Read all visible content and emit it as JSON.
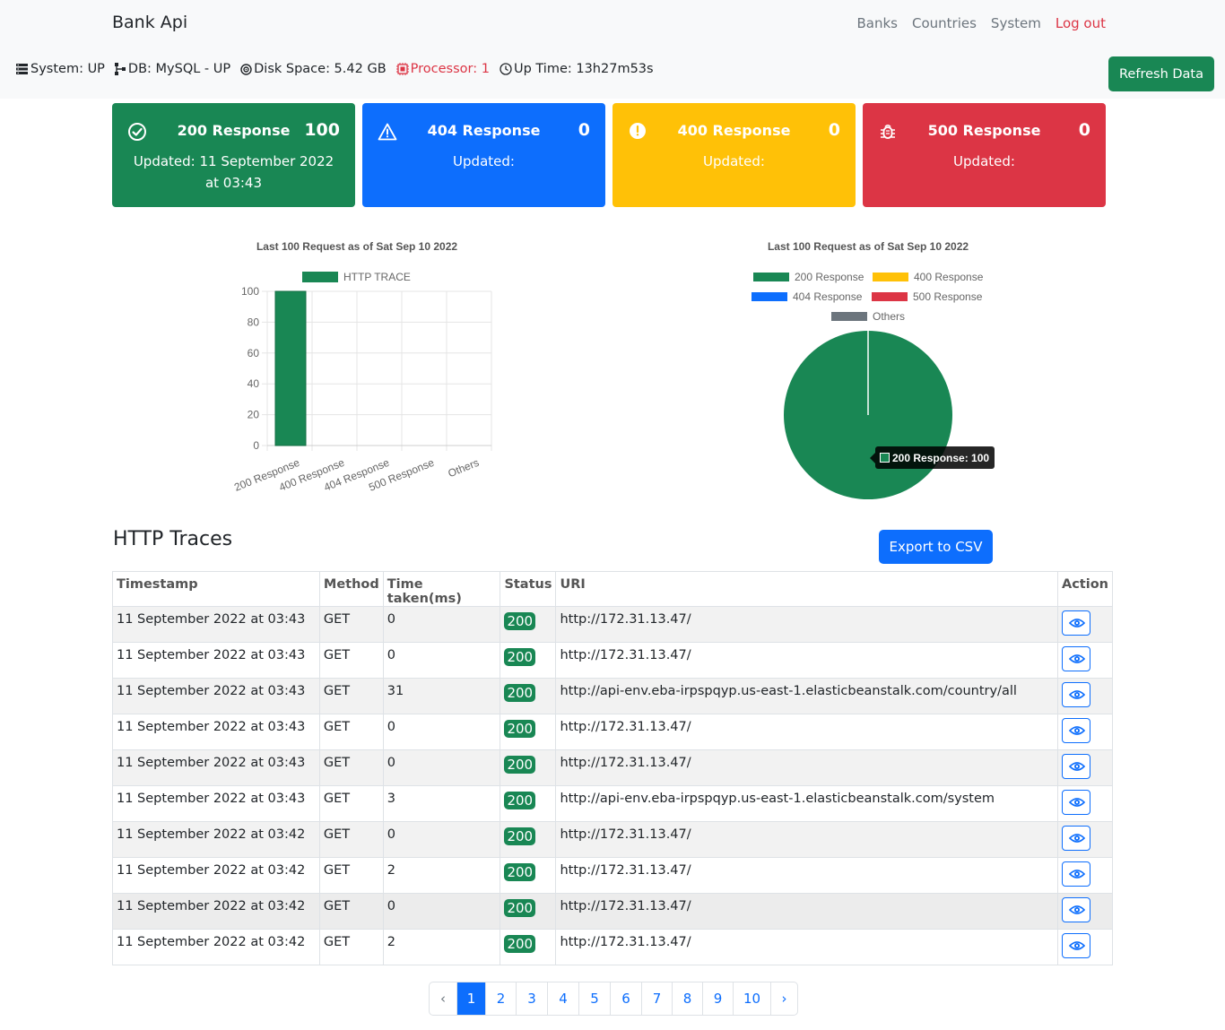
{
  "nav": {
    "brand": "Bank Api",
    "links": [
      "Banks",
      "Countries",
      "System"
    ],
    "logout": "Log out"
  },
  "status": {
    "system": "System: UP",
    "db": "DB: MySQL - UP",
    "disk": "Disk Space: 5.42 GB",
    "processor": "Processor: 1",
    "uptime": "Up Time: 13h27m53s"
  },
  "refresh_label": "Refresh Data",
  "cards": [
    {
      "title": "200 Response",
      "count": "100",
      "updated": "Updated: 11 September 2022 at 03:43",
      "color": "#198754",
      "icon": "check-circle-icon"
    },
    {
      "title": "404 Response",
      "count": "0",
      "updated": "Updated:",
      "color": "#0d6efd",
      "icon": "warning-triangle-icon"
    },
    {
      "title": "400 Response",
      "count": "0",
      "updated": "Updated:",
      "color": "#ffc107",
      "icon": "exclamation-circle-icon"
    },
    {
      "title": "500 Response",
      "count": "0",
      "updated": "Updated:",
      "color": "#dc3545",
      "icon": "bug-icon"
    }
  ],
  "chart_data": [
    {
      "type": "bar",
      "title": "Last 100 Request as of Sat Sep 10 2022",
      "categories": [
        "200 Response",
        "400 Response",
        "404 Response",
        "500 Response",
        "Others"
      ],
      "series": [
        {
          "name": "HTTP TRACE",
          "values": [
            100,
            0,
            0,
            0,
            0
          ]
        }
      ],
      "ylim": [
        0,
        100
      ],
      "yticks": [
        0,
        20,
        40,
        60,
        80,
        100
      ],
      "color": "#198754",
      "legend": "top"
    },
    {
      "type": "pie",
      "title": "Last 100 Request as of Sat Sep 10 2022",
      "labels": [
        "200 Response",
        "400 Response",
        "404 Response",
        "500 Response",
        "Others"
      ],
      "values": [
        100,
        0,
        0,
        0,
        0
      ],
      "colors": [
        "#198754",
        "#ffc107",
        "#0d6efd",
        "#dc3545",
        "#6c757d"
      ],
      "legend": "top",
      "tooltip": "200 Response: 100"
    }
  ],
  "traces": {
    "title": "HTTP Traces",
    "export_label": "Export to CSV",
    "columns": [
      "Timestamp",
      "Method",
      "Time taken(ms)",
      "Status",
      "URI",
      "Action"
    ],
    "rows": [
      {
        "timestamp": "11 September 2022 at 03:43",
        "method": "GET",
        "time": "0",
        "status": "200",
        "uri": "http://172.31.13.47/"
      },
      {
        "timestamp": "11 September 2022 at 03:43",
        "method": "GET",
        "time": "0",
        "status": "200",
        "uri": "http://172.31.13.47/"
      },
      {
        "timestamp": "11 September 2022 at 03:43",
        "method": "GET",
        "time": "31",
        "status": "200",
        "uri": "http://api-env.eba-irpspqyp.us-east-1.elasticbeanstalk.com/country/all"
      },
      {
        "timestamp": "11 September 2022 at 03:43",
        "method": "GET",
        "time": "0",
        "status": "200",
        "uri": "http://172.31.13.47/"
      },
      {
        "timestamp": "11 September 2022 at 03:43",
        "method": "GET",
        "time": "0",
        "status": "200",
        "uri": "http://172.31.13.47/"
      },
      {
        "timestamp": "11 September 2022 at 03:43",
        "method": "GET",
        "time": "3",
        "status": "200",
        "uri": "http://api-env.eba-irpspqyp.us-east-1.elasticbeanstalk.com/system"
      },
      {
        "timestamp": "11 September 2022 at 03:42",
        "method": "GET",
        "time": "0",
        "status": "200",
        "uri": "http://172.31.13.47/"
      },
      {
        "timestamp": "11 September 2022 at 03:42",
        "method": "GET",
        "time": "2",
        "status": "200",
        "uri": "http://172.31.13.47/"
      },
      {
        "timestamp": "11 September 2022 at 03:42",
        "method": "GET",
        "time": "0",
        "status": "200",
        "uri": "http://172.31.13.47/"
      },
      {
        "timestamp": "11 September 2022 at 03:42",
        "method": "GET",
        "time": "2",
        "status": "200",
        "uri": "http://172.31.13.47/"
      }
    ]
  },
  "pagination": {
    "prev": "‹",
    "pages": [
      "1",
      "2",
      "3",
      "4",
      "5",
      "6",
      "7",
      "8",
      "9",
      "10"
    ],
    "current": "1",
    "next": "›"
  }
}
